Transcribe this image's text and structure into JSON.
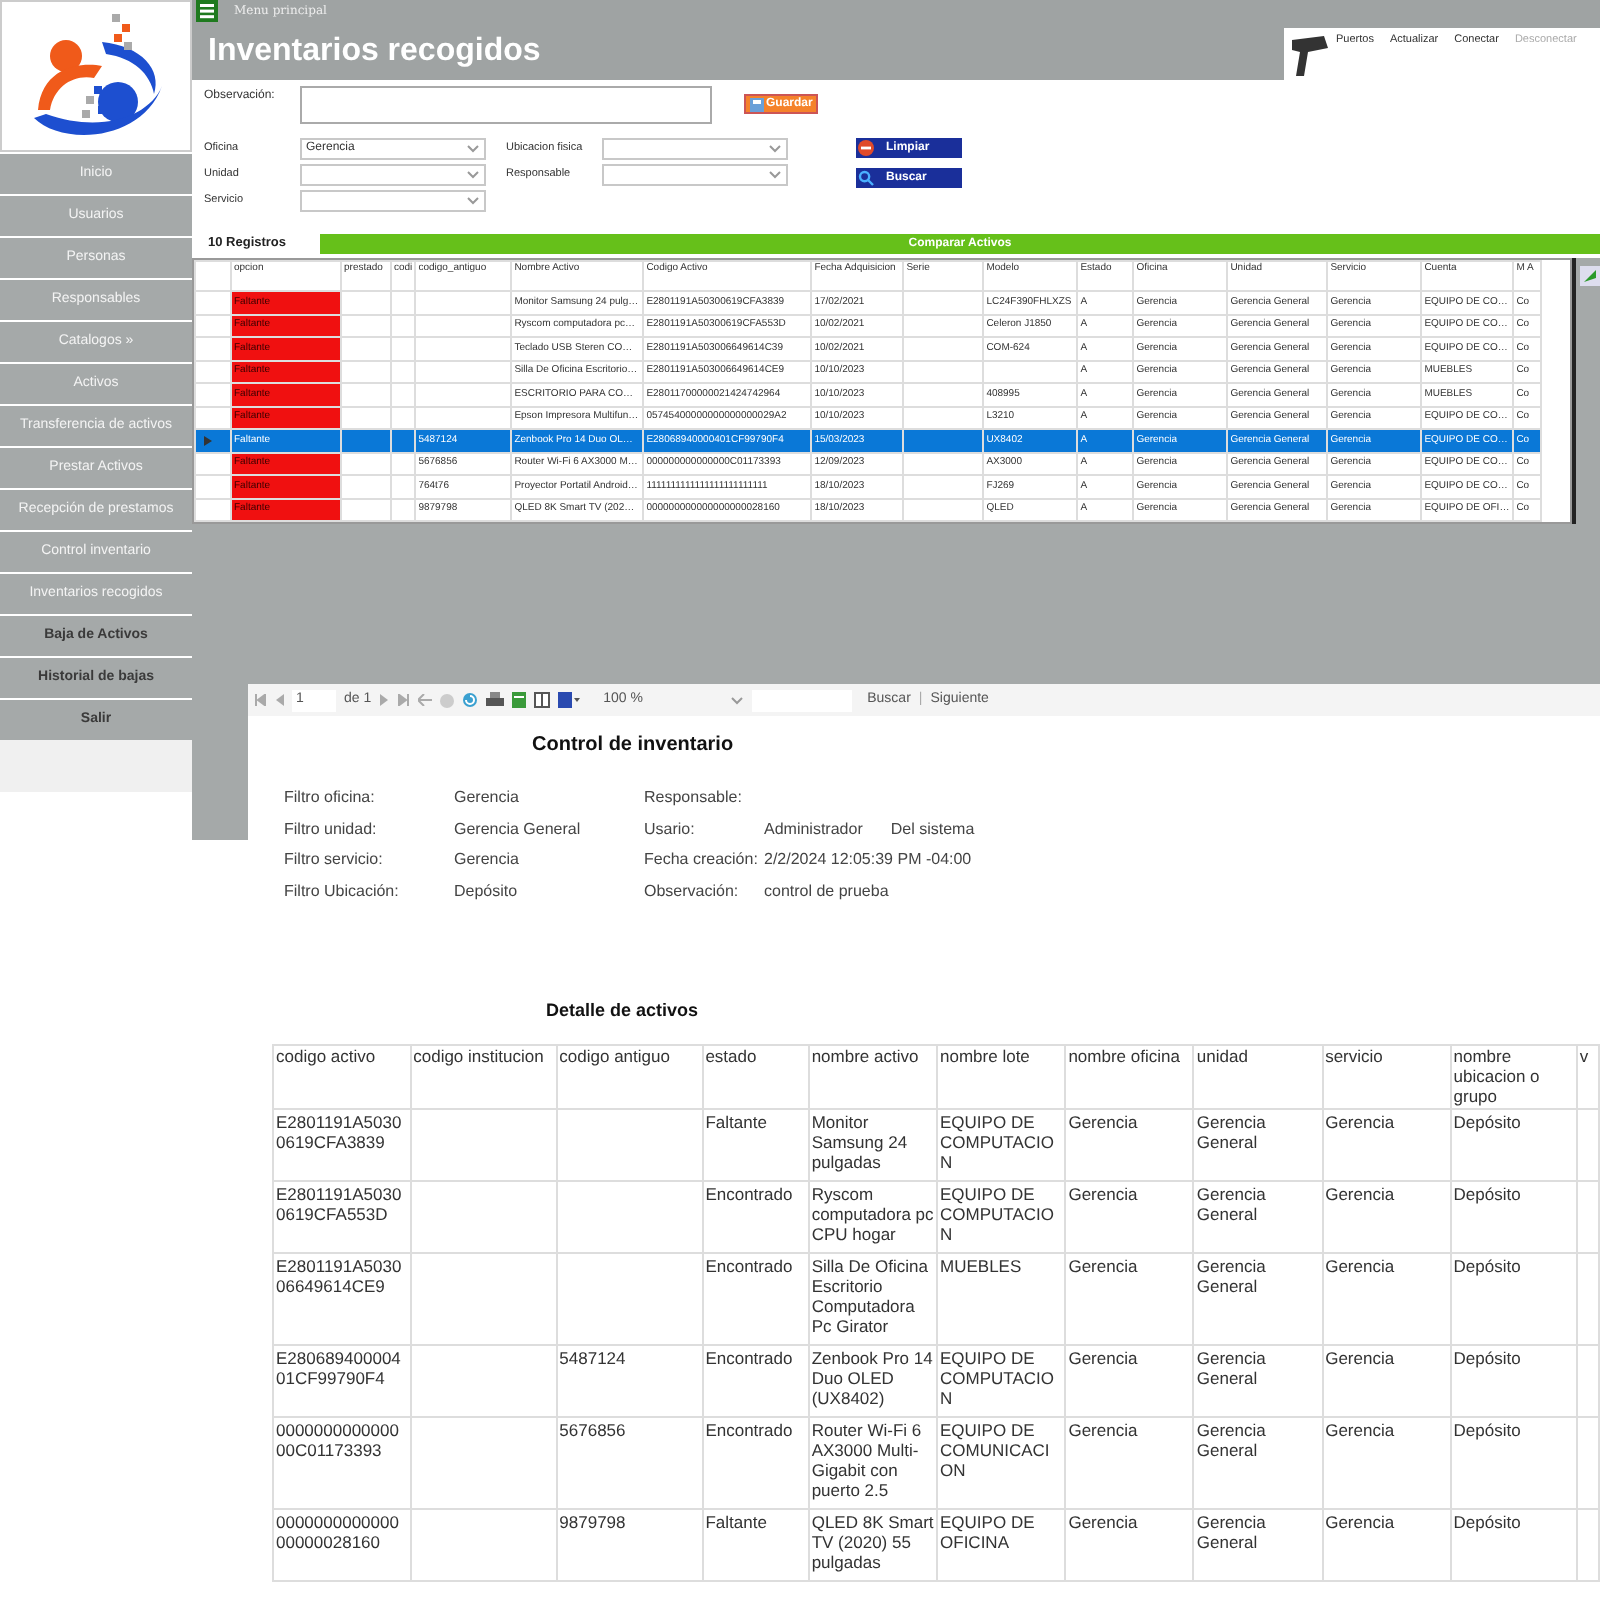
{
  "header": {
    "menu_title": "Menu principal",
    "title": "Inventarios recogidos"
  },
  "device_panel": {
    "links": [
      {
        "label": "Puertos",
        "disabled": false
      },
      {
        "label": "Actualizar",
        "disabled": false
      },
      {
        "label": "Conectar",
        "disabled": false
      },
      {
        "label": "Desconectar",
        "disabled": true
      }
    ]
  },
  "sidebar": {
    "items": [
      {
        "label": "Inicio",
        "bold": false
      },
      {
        "label": "Usuarios",
        "bold": false
      },
      {
        "label": "Personas",
        "bold": false
      },
      {
        "label": "Responsables",
        "bold": false
      },
      {
        "label": "Catalogos »",
        "bold": false
      },
      {
        "label": "Activos",
        "bold": false
      },
      {
        "label": "Transferencia de activos",
        "bold": false
      },
      {
        "label": "Prestar Activos",
        "bold": false
      },
      {
        "label": "Recepción de prestamos",
        "bold": false
      },
      {
        "label": "Control inventario",
        "bold": false
      },
      {
        "label": "Inventarios recogidos",
        "bold": false
      },
      {
        "label": "Baja de Activos",
        "bold": true
      },
      {
        "label": "Historial de bajas",
        "bold": true
      },
      {
        "label": "Salir",
        "bold": true
      }
    ]
  },
  "form": {
    "observacion_label": "Observación:",
    "guardar_button": "Guardar",
    "fields_left": [
      {
        "label": "Oficina",
        "value": "Gerencia"
      },
      {
        "label": "Unidad"
      },
      {
        "label": "Servicio"
      }
    ],
    "fields_right": [
      {
        "label": "Ubicacion fisica"
      },
      {
        "label": "Responsable"
      }
    ],
    "limpiar_button": "Limpiar",
    "buscar_button": "Buscar"
  },
  "records": {
    "count": "10 Registros",
    "compare_button": "Comparar Activos"
  },
  "grid": {
    "columns": [
      "opcion",
      "prestado",
      "codi",
      "codigo_antiguo",
      "Nombre Activo",
      "Codigo Activo",
      "Fecha Adquisicion",
      "Serie",
      "Modelo",
      "Estado",
      "Oficina",
      "Unidad",
      "Servicio",
      "Cuenta",
      "M A"
    ],
    "rows": [
      {
        "selected": false,
        "opcion": "Faltante",
        "nombre_activo": "Monitor Samsung 24 pulg…",
        "codigo_activo": "E2801191A50300619CFA3839",
        "fecha": "17/02/2021",
        "modelo": "LC24F390FHLXZS",
        "estado": "A",
        "oficina": "Gerencia",
        "unidad": "Gerencia General",
        "servicio": "Gerencia",
        "cuenta": "EQUIPO DE CO…",
        "column_15": "Co"
      },
      {
        "selected": false,
        "opcion": "Faltante",
        "nombre_activo": "Ryscom computadora pc…",
        "codigo_activo": "E2801191A50300619CFA553D",
        "fecha": "10/02/2021",
        "modelo": "Celeron J1850",
        "estado": "A",
        "oficina": "Gerencia",
        "unidad": "Gerencia General",
        "servicio": "Gerencia",
        "cuenta": "EQUIPO DE CO…",
        "column_15": "Co"
      },
      {
        "selected": false,
        "opcion": "Faltante",
        "nombre_activo": "Teclado USB Steren CO…",
        "codigo_activo": "E2801191A503006649614C39",
        "fecha": "10/02/2021",
        "modelo": "COM-624",
        "estado": "A",
        "oficina": "Gerencia",
        "unidad": "Gerencia General",
        "servicio": "Gerencia",
        "cuenta": "EQUIPO DE CO…",
        "column_15": "Co"
      },
      {
        "selected": false,
        "opcion": "Faltante",
        "nombre_activo": "Silla De Oficina Escritorio…",
        "codigo_activo": "E2801191A503006649614CE9",
        "fecha": "10/10/2023",
        "estado": "A",
        "oficina": "Gerencia",
        "unidad": "Gerencia General",
        "servicio": "Gerencia",
        "cuenta": "MUEBLES",
        "column_15": "Co"
      },
      {
        "selected": false,
        "opcion": "Faltante",
        "nombre_activo": "ESCRITORIO PARA CO…",
        "codigo_activo": "E28011700000021424742964",
        "fecha": "10/10/2023",
        "modelo": "408995",
        "estado": "A",
        "oficina": "Gerencia",
        "unidad": "Gerencia General",
        "servicio": "Gerencia",
        "cuenta": "MUEBLES",
        "column_15": "Co"
      },
      {
        "selected": false,
        "opcion": "Faltante",
        "nombre_activo": "Epson Impresora Multifun…",
        "codigo_activo": "05745400000000000000029A2",
        "fecha": "10/10/2023",
        "modelo": "L3210",
        "estado": "A",
        "oficina": "Gerencia",
        "unidad": "Gerencia General",
        "servicio": "Gerencia",
        "cuenta": "EQUIPO DE CO…",
        "column_15": "Co"
      },
      {
        "selected": true,
        "opcion": "Faltante",
        "codigo_antiguo": "5487124",
        "nombre_activo": "Zenbook Pro 14 Duo OL…",
        "codigo_activo": "E28068940000401CF99790F4",
        "fecha": "15/03/2023",
        "modelo": "UX8402",
        "estado": "A",
        "oficina": "Gerencia",
        "unidad": "Gerencia General",
        "servicio": "Gerencia",
        "cuenta": "EQUIPO DE CO…",
        "column_15": "Co"
      },
      {
        "selected": false,
        "opcion": "Faltante",
        "codigo_antiguo": "5676856",
        "nombre_activo": "Router Wi-Fi 6 AX3000 M…",
        "codigo_activo": "000000000000000C01173393",
        "fecha": "12/09/2023",
        "modelo": "AX3000",
        "estado": "A",
        "oficina": "Gerencia",
        "unidad": "Gerencia General",
        "servicio": "Gerencia",
        "cuenta": "EQUIPO DE CO…",
        "column_15": "Co"
      },
      {
        "selected": false,
        "opcion": "Faltante",
        "codigo_antiguo": "764t76",
        "nombre_activo": "Proyector Portatil Android…",
        "codigo_activo": "1111111111111111111111111",
        "fecha": "18/10/2023",
        "modelo": "FJ269",
        "estado": "A",
        "oficina": "Gerencia",
        "unidad": "Gerencia General",
        "servicio": "Gerencia",
        "cuenta": "EQUIPO DE CO…",
        "column_15": "Co"
      },
      {
        "selected": false,
        "opcion": "Faltante",
        "codigo_antiguo": "9879798",
        "nombre_activo": "QLED 8K Smart TV (202…",
        "codigo_activo": "000000000000000000028160",
        "fecha": "18/10/2023",
        "modelo": "QLED",
        "estado": "A",
        "oficina": "Gerencia",
        "unidad": "Gerencia General",
        "servicio": "Gerencia",
        "cuenta": "EQUIPO DE OFI…",
        "column_15": "Co"
      }
    ]
  },
  "report": {
    "toolbar": {
      "page": "1",
      "of_pages": "de 1",
      "zoom": "100 %",
      "find": "Buscar",
      "separator": "|",
      "next": "Siguiente"
    },
    "title": "Control de inventario",
    "filters": [
      {
        "label": "Filtro oficina:",
        "value": "Gerencia"
      },
      {
        "label": "Filtro unidad:",
        "value": "Gerencia General"
      },
      {
        "label": "Filtro servicio:",
        "value": "Gerencia"
      },
      {
        "label": "Filtro Ubicación:",
        "value": "Depósito"
      }
    ],
    "info": [
      {
        "label": "Responsable:"
      },
      {
        "label": "Usario:",
        "values": [
          "Administrador",
          "Del sistema"
        ]
      },
      {
        "label": "Fecha creación:",
        "values": [
          "2/2/2024 12:05:39 PM -04:00"
        ]
      },
      {
        "label": "Observación:",
        "values": [
          "control de prueba"
        ]
      }
    ],
    "detail": {
      "title": "Detalle de activos",
      "columns": [
        "codigo activo",
        "codigo institucion",
        "codigo antiguo",
        "estado",
        "nombre activo",
        "nombre lote",
        "nombre oficina",
        "unidad",
        "servicio",
        "nombre ubicacion o grupo",
        "v"
      ],
      "rows": [
        {
          "codigo_activo": "E2801191A50300619CFA3839",
          "estado": "Faltante",
          "nombre_activo": "Monitor Samsung 24 pulgadas",
          "nombre_lote": "EQUIPO DE COMPUTACION",
          "nombre_oficina": "Gerencia",
          "unidad": "Gerencia General",
          "servicio": "Gerencia",
          "ubicacion": "Depósito"
        },
        {
          "codigo_activo": "E2801191A50300619CFA553D",
          "estado": "Encontrado",
          "nombre_activo": "Ryscom computadora pc CPU hogar",
          "nombre_lote": "EQUIPO DE COMPUTACION",
          "nombre_oficina": "Gerencia",
          "unidad": "Gerencia General",
          "servicio": "Gerencia",
          "ubicacion": "Depósito"
        },
        {
          "codigo_activo": "E2801191A503006649614CE9",
          "estado": "Encontrado",
          "nombre_activo": "Silla De Oficina Escritorio Computadora Pc Girator",
          "nombre_lote": "MUEBLES",
          "nombre_oficina": "Gerencia",
          "unidad": "Gerencia General",
          "servicio": "Gerencia",
          "ubicacion": "Depósito"
        },
        {
          "codigo_activo": "E28068940000401CF99790F4",
          "codigo_antiguo": "5487124",
          "estado": "Encontrado",
          "nombre_activo": "Zenbook Pro 14 Duo OLED (UX8402)",
          "nombre_lote": "EQUIPO DE COMPUTACION",
          "nombre_oficina": "Gerencia",
          "unidad": "Gerencia General",
          "servicio": "Gerencia",
          "ubicacion": "Depósito"
        },
        {
          "codigo_activo": "000000000000000C01173393",
          "codigo_antiguo": "5676856",
          "estado": "Encontrado",
          "nombre_activo": "Router Wi-Fi 6 AX3000 Multi-Gigabit con puerto 2.5",
          "nombre_lote": "EQUIPO DE COMUNICACION",
          "nombre_oficina": "Gerencia",
          "unidad": "Gerencia General",
          "servicio": "Gerencia",
          "ubicacion": "Depósito"
        },
        {
          "codigo_activo": "000000000000000000028160",
          "codigo_antiguo": "9879798",
          "estado": "Faltante",
          "nombre_activo": "QLED 8K Smart TV (2020) 55 pulgadas",
          "nombre_lote": "EQUIPO DE OFICINA",
          "nombre_oficina": "Gerencia",
          "unidad": "Gerencia General",
          "servicio": "Gerencia",
          "ubicacion": "Depósito"
        }
      ]
    }
  }
}
